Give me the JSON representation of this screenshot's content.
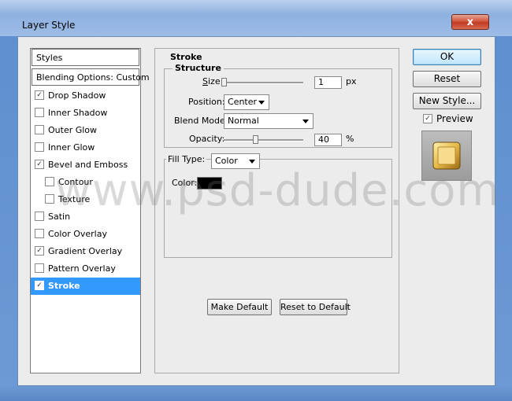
{
  "window": {
    "title": "Layer Style",
    "close_label": "x"
  },
  "sidebar": {
    "styles_label": "Styles",
    "blending_label": "Blending Options: Custom",
    "items": [
      {
        "label": "Drop Shadow",
        "checked": true
      },
      {
        "label": "Inner Shadow",
        "checked": false
      },
      {
        "label": "Outer Glow",
        "checked": false
      },
      {
        "label": "Inner Glow",
        "checked": false
      },
      {
        "label": "Bevel and Emboss",
        "checked": true
      },
      {
        "label": "Contour",
        "checked": false
      },
      {
        "label": "Texture",
        "checked": false
      },
      {
        "label": "Satin",
        "checked": false
      },
      {
        "label": "Color Overlay",
        "checked": false
      },
      {
        "label": "Gradient Overlay",
        "checked": true
      },
      {
        "label": "Pattern Overlay",
        "checked": false
      },
      {
        "label": "Stroke",
        "checked": true,
        "selected": true
      }
    ]
  },
  "stroke": {
    "title": "Stroke",
    "structure_title": "Structure",
    "size_label": "Size:",
    "size_value": "1",
    "size_unit": "px",
    "size_slider_fraction": 0.0,
    "position_label": "Position:",
    "position_value": "Center",
    "blend_mode_label": "Blend Mode:",
    "blend_mode_value": "Normal",
    "opacity_label": "Opacity:",
    "opacity_value": "40",
    "opacity_unit": "%",
    "opacity_slider_fraction": 0.4,
    "fill_type_label": "Fill Type:",
    "fill_type_value": "Color",
    "color_label": "Color:",
    "color_value": "#000000",
    "make_default_label": "Make Default",
    "reset_default_label": "Reset to Default"
  },
  "actions": {
    "ok_label": "OK",
    "reset_label": "Reset",
    "new_style_label": "New Style...",
    "preview_label": "Preview",
    "preview_checked": true
  },
  "watermark": "www.psd-dude.com"
}
